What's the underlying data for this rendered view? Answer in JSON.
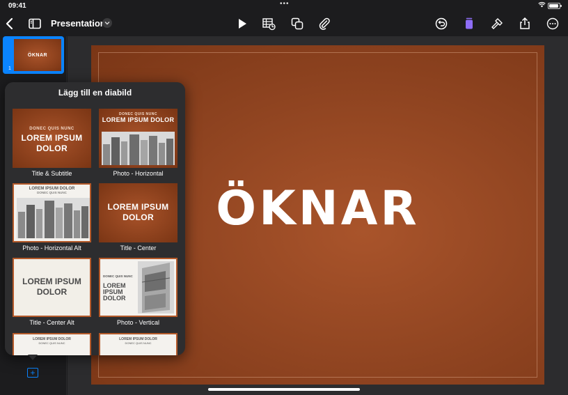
{
  "status": {
    "time": "09:41",
    "dots": "•••"
  },
  "toolbar": {
    "doc_title": "Presentation",
    "accent": "#0a84ff",
    "icons": [
      "back-chevron-icon",
      "sidebar-toggle-icon",
      "play-icon",
      "table-chart-icon",
      "shapes-icon",
      "attach-icon",
      "undo-icon",
      "format-icon",
      "tools-icon",
      "share-icon",
      "more-icon"
    ]
  },
  "sidebar": {
    "slides": [
      {
        "number": "1",
        "title": "ÖKNAR"
      }
    ],
    "add_icon": "+"
  },
  "slide": {
    "title": "ÖKNAR",
    "background": "#8e4320"
  },
  "popover": {
    "title": "Lägg till en diabild",
    "layouts": [
      {
        "label": "Title & Subtitle",
        "sub": "DONEC QUIS NUNC",
        "big": [
          "LOREM IPSUM",
          "DOLOR"
        ]
      },
      {
        "label": "Photo - Horizontal",
        "sub": "DONEC QUIS NUNC",
        "big": [
          "LOREM IPSUM DOLOR"
        ]
      },
      {
        "label": "Photo - Horizontal Alt",
        "sub": "LOREM IPSUM DOLOR",
        "small": "DONEC QUIS NUNC"
      },
      {
        "label": "Title - Center",
        "big": [
          "LOREM IPSUM",
          "DOLOR"
        ]
      },
      {
        "label": "Title - Center Alt",
        "big": [
          "LOREM IPSUM",
          "DOLOR"
        ]
      },
      {
        "label": "Photo - Vertical",
        "sub": "DONEC QUIS NUNC",
        "big": [
          "LOREM",
          "IPSUM",
          "DOLOR"
        ]
      },
      {
        "label": "",
        "sub": "LOREM IPSUM DOLOR",
        "small": "DONEC QUIS NUNC"
      },
      {
        "label": "",
        "sub": "LOREM IPSUM DOLOR",
        "small": "DONEC QUIS NUNC"
      }
    ]
  }
}
